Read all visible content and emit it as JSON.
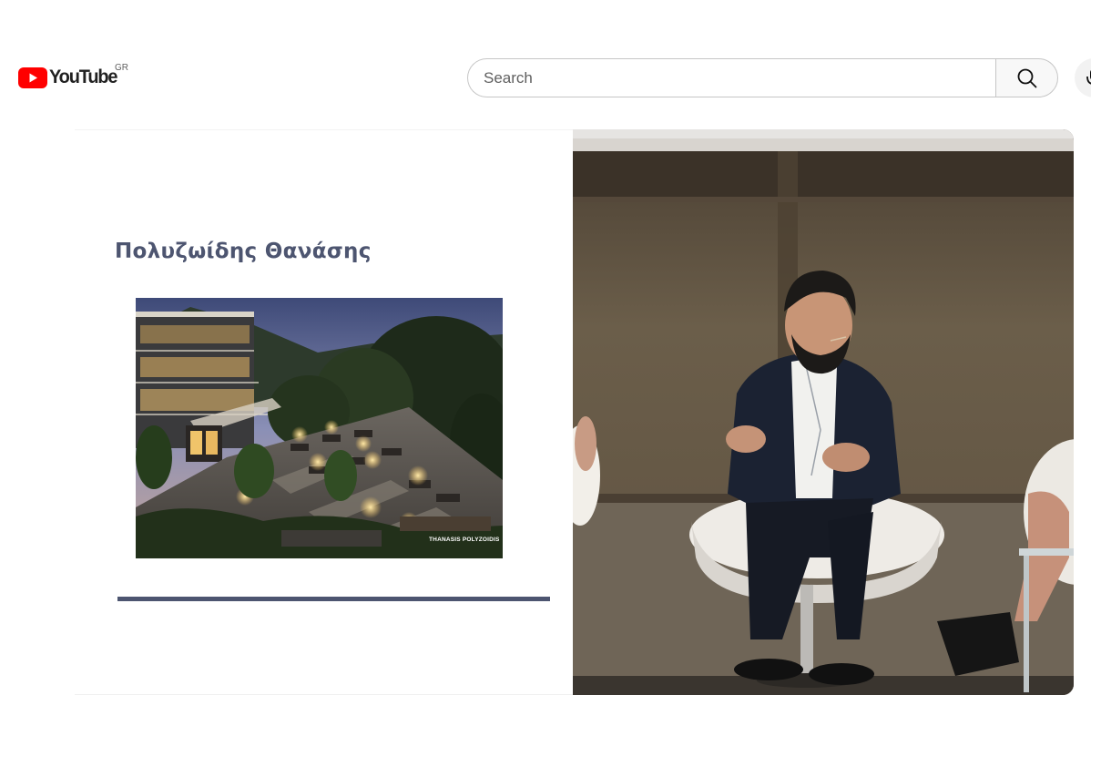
{
  "header": {
    "logo_text": "YouTube",
    "country_code": "GR",
    "search": {
      "placeholder": "Search",
      "value": ""
    },
    "icons": [
      "youtube-play-icon",
      "search-icon",
      "mic-icon"
    ]
  },
  "video": {
    "slide": {
      "title": "Πολυζωίδης Θανάσης",
      "photo_credit": "THANASIS POLYZOIDIS"
    }
  },
  "colors": {
    "brand_red": "#ff0000",
    "slide_accent": "#4d5570"
  }
}
